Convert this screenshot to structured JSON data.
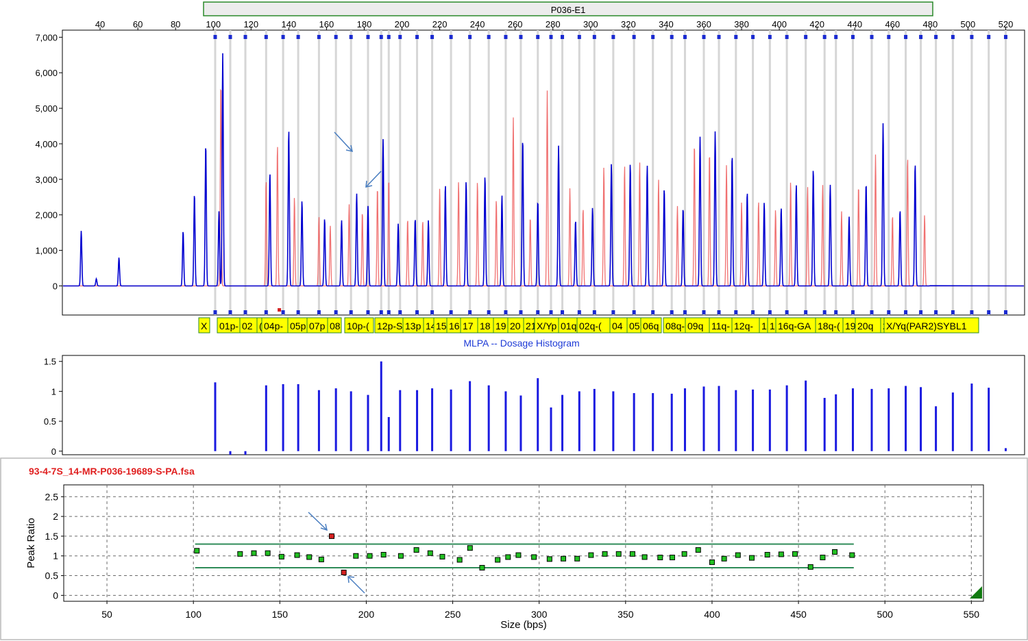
{
  "electropherogram": {
    "probe_mix_label": "P036-E1",
    "x_ticks": [
      40,
      60,
      80,
      100,
      120,
      140,
      160,
      180,
      200,
      220,
      240,
      260,
      280,
      300,
      320,
      340,
      360,
      380,
      400,
      420,
      440,
      460,
      480,
      500,
      520
    ],
    "y_ticks": [
      0,
      1000,
      2000,
      3000,
      4000,
      5000,
      6000,
      7000
    ],
    "y_tick_labels": [
      "0",
      "1,000",
      "2,000",
      "3,000",
      "4,000",
      "5,000",
      "6,000",
      "7,000"
    ],
    "xlim": [
      20,
      530
    ],
    "ylim": [
      -820,
      7200
    ],
    "probe_labels": [
      "X",
      "01p-",
      "02",
      "(",
      "04p-",
      "05p",
      "07p",
      "08",
      "10p-(",
      "12p-S",
      "13p",
      "14",
      "15",
      "16",
      "17",
      "18",
      "19",
      "20",
      "21",
      "X/Yp",
      "01q",
      "02q-(",
      "04",
      "05",
      "06q",
      "08q-",
      "09q",
      "11q-",
      "12q-",
      "1",
      "1",
      "16q-GA",
      "18q-(",
      "19",
      "20q",
      "21",
      "X/Yq(PAR2)SYBL1"
    ],
    "blue_peaks": [
      [
        30,
        1550
      ],
      [
        38,
        200
      ],
      [
        50,
        800
      ],
      [
        84,
        1550
      ],
      [
        90,
        2600
      ],
      [
        96,
        4000
      ],
      [
        103,
        2100
      ],
      [
        105,
        6550
      ],
      [
        130,
        3200
      ],
      [
        140,
        4400
      ],
      [
        147,
        2400
      ],
      [
        159,
        1900
      ],
      [
        168,
        1850
      ],
      [
        176,
        2600
      ],
      [
        182,
        2250
      ],
      [
        190,
        4130
      ],
      [
        198,
        1750
      ],
      [
        207,
        1900
      ],
      [
        214,
        1850
      ],
      [
        223,
        2850
      ],
      [
        234,
        2950
      ],
      [
        244,
        3100
      ],
      [
        253,
        2550
      ],
      [
        264,
        4150
      ],
      [
        272,
        2400
      ],
      [
        283,
        3950
      ],
      [
        292,
        1850
      ],
      [
        301,
        2200
      ],
      [
        311,
        3450
      ],
      [
        321,
        3450
      ],
      [
        330,
        3400
      ],
      [
        339,
        2750
      ],
      [
        349,
        2200
      ],
      [
        358,
        4200
      ],
      [
        366,
        4350
      ],
      [
        375,
        3700
      ],
      [
        383,
        2650
      ],
      [
        392,
        2350
      ],
      [
        401,
        2200
      ],
      [
        409,
        2850
      ],
      [
        418,
        3300
      ],
      [
        427,
        2850
      ],
      [
        437,
        1950
      ],
      [
        446,
        2900
      ],
      [
        455,
        4580
      ],
      [
        464,
        2150
      ],
      [
        472,
        3450
      ],
      [
        481,
        2150
      ],
      [
        489,
        4350
      ],
      [
        498,
        2800
      ],
      [
        506,
        2150
      ],
      [
        515,
        2950
      ],
      [
        522,
        3200
      ]
    ],
    "red_peaks": [
      [
        104,
        5800
      ],
      [
        128,
        3000
      ],
      [
        134,
        4000
      ],
      [
        143,
        2500
      ],
      [
        156,
        1950
      ],
      [
        162,
        1700
      ],
      [
        172,
        2300
      ],
      [
        179,
        2100
      ],
      [
        187,
        2800
      ],
      [
        193,
        3050
      ],
      [
        203,
        1900
      ],
      [
        211,
        1850
      ],
      [
        220,
        2750
      ],
      [
        230,
        2950
      ],
      [
        240,
        2950
      ],
      [
        250,
        2450
      ],
      [
        259,
        4750
      ],
      [
        268,
        1950
      ],
      [
        277,
        5500
      ],
      [
        289,
        2750
      ],
      [
        296,
        2200
      ],
      [
        307,
        3350
      ],
      [
        318,
        3400
      ],
      [
        326,
        3500
      ],
      [
        336,
        3000
      ],
      [
        346,
        2250
      ],
      [
        355,
        4050
      ],
      [
        363,
        3800
      ],
      [
        372,
        3400
      ],
      [
        380,
        2350
      ],
      [
        389,
        2400
      ],
      [
        398,
        2150
      ],
      [
        406,
        2950
      ],
      [
        415,
        2800
      ],
      [
        423,
        2850
      ],
      [
        433,
        2100
      ],
      [
        442,
        2850
      ],
      [
        451,
        3700
      ],
      [
        460,
        2000
      ],
      [
        468,
        3650
      ],
      [
        477,
        2000
      ],
      [
        485,
        4150
      ],
      [
        495,
        3550
      ],
      [
        503,
        2350
      ],
      [
        511,
        2750
      ],
      [
        520,
        3000
      ]
    ],
    "annotation_arrows": 2
  },
  "histogram": {
    "title": "MLPA -- Dosage Histogram",
    "y_ticks": [
      0,
      0.5,
      1,
      1.5
    ],
    "y_tick_labels": [
      "0",
      "0.5",
      "1",
      "1.5"
    ],
    "ylim": [
      -0.06,
      1.6
    ]
  },
  "ratio_plot": {
    "file_name": "93-4-7S_14-MR-P036-19689-S-PA.fsa",
    "xlabel": "Size (bps)",
    "ylabel": "Peak Ratio",
    "x_ticks": [
      50,
      100,
      150,
      200,
      250,
      300,
      350,
      400,
      450,
      500,
      550
    ],
    "y_ticks": [
      0,
      0.5,
      1,
      1.5,
      2,
      2.5
    ],
    "y_tick_labels": [
      "0",
      "0.5",
      "1",
      "1.5",
      "2",
      "2.5"
    ],
    "xlim": [
      25,
      557
    ],
    "ylim": [
      -0.15,
      2.8
    ],
    "upper_threshold": 1.3,
    "lower_threshold": 0.7,
    "threshold_x": [
      101,
      482
    ],
    "threshold_color": "#2e8b57",
    "normal_color": "#22c022",
    "abnormal_color": "#d42020"
  },
  "chart_data": [
    {
      "type": "line",
      "title": "P036-E1",
      "xlabel": "",
      "ylabel": "",
      "xlim": [
        20,
        530
      ],
      "ylim": [
        -820,
        7200
      ],
      "grid": false,
      "series": [
        {
          "name": "",
          "color": "#0000d0"
        },
        {
          "name": "",
          "color": "#f07070"
        }
      ]
    },
    {
      "type": "bar",
      "title": "MLPA -- Dosage Histogram",
      "ylim": [
        -0.06,
        1.6
      ],
      "x": [
        101,
        109,
        117,
        128,
        137,
        145,
        156,
        165,
        173,
        182,
        189,
        193,
        199,
        208,
        216,
        226,
        236,
        246,
        255,
        263,
        272,
        279,
        285,
        294,
        302,
        312,
        323,
        333,
        343,
        350,
        360,
        368,
        377,
        386,
        395,
        404,
        414,
        424,
        430,
        439,
        449,
        458,
        467,
        475,
        483,
        492,
        502,
        511,
        520
      ],
      "values": [
        1.15,
        -0.06,
        -0.06,
        1.1,
        1.12,
        1.12,
        1.02,
        1.05,
        1.0,
        0.94,
        1.5,
        0.57,
        1.02,
        1.02,
        1.05,
        1.03,
        1.17,
        1.1,
        1.0,
        0.93,
        1.22,
        0.73,
        0.94,
        1.0,
        1.04,
        1.0,
        0.97,
        0.97,
        0.96,
        1.05,
        1.08,
        1.09,
        1.02,
        1.03,
        1.03,
        1.1,
        1.18,
        0.89,
        0.95,
        1.05,
        1.04,
        1.05,
        1.09,
        1.07,
        0.75,
        0.98,
        1.13,
        1.06,
        0.05
      ]
    },
    {
      "type": "scatter",
      "title": "93-4-7S_14-MR-P036-19689-S-PA.fsa",
      "xlabel": "Size (bps)",
      "ylabel": "Peak Ratio",
      "xlim": [
        25,
        557
      ],
      "ylim": [
        -0.15,
        2.8
      ],
      "grid": true,
      "points": [
        [
          102,
          1.13
        ],
        [
          127,
          1.05
        ],
        [
          135,
          1.07
        ],
        [
          143,
          1.07
        ],
        [
          151,
          0.98
        ],
        [
          160,
          1.02
        ],
        [
          167,
          0.97
        ],
        [
          174,
          0.91
        ],
        [
          180,
          1.5
        ],
        [
          187,
          0.58
        ],
        [
          194,
          1.0
        ],
        [
          202,
          1.0
        ],
        [
          210,
          1.03
        ],
        [
          220,
          1.0
        ],
        [
          229,
          1.15
        ],
        [
          237,
          1.07
        ],
        [
          244,
          0.98
        ],
        [
          254,
          0.9
        ],
        [
          260,
          1.2
        ],
        [
          267,
          0.7
        ],
        [
          276,
          0.9
        ],
        [
          282,
          0.97
        ],
        [
          288,
          1.02
        ],
        [
          297,
          0.97
        ],
        [
          306,
          0.92
        ],
        [
          314,
          0.93
        ],
        [
          322,
          0.93
        ],
        [
          330,
          1.02
        ],
        [
          338,
          1.05
        ],
        [
          346,
          1.05
        ],
        [
          354,
          1.05
        ],
        [
          361,
          0.97
        ],
        [
          370,
          0.96
        ],
        [
          377,
          0.96
        ],
        [
          384,
          1.05
        ],
        [
          392,
          1.15
        ],
        [
          400,
          0.84
        ],
        [
          407,
          0.93
        ],
        [
          415,
          1.02
        ],
        [
          423,
          0.95
        ],
        [
          432,
          1.03
        ],
        [
          440,
          1.04
        ],
        [
          448,
          1.05
        ],
        [
          457,
          0.72
        ],
        [
          464,
          0.96
        ],
        [
          471,
          1.1
        ],
        [
          481,
          1.02
        ]
      ],
      "abnormal_indices": [
        8,
        9
      ],
      "thresholds": [
        0.7,
        1.3
      ]
    }
  ]
}
